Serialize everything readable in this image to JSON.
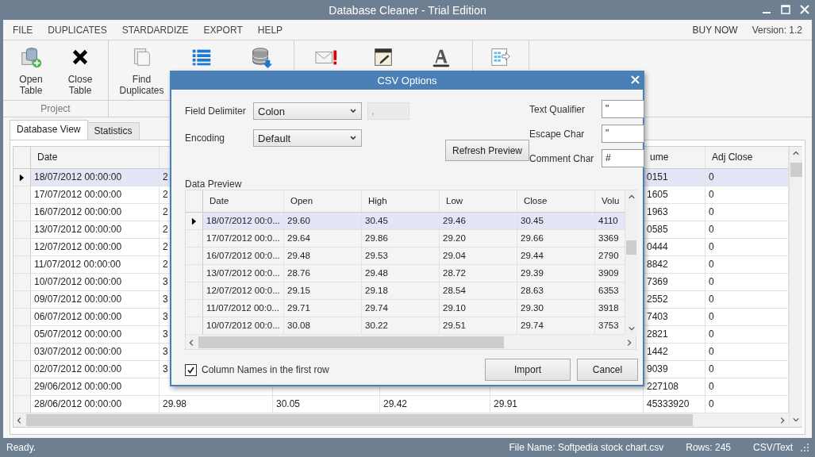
{
  "window": {
    "title": "Database Cleaner - Trial Edition"
  },
  "menu": {
    "items": [
      {
        "label": "FILE"
      },
      {
        "label": "DUPLICATES"
      },
      {
        "label": "STARDARDIZE"
      },
      {
        "label": "EXPORT"
      },
      {
        "label": "HELP"
      }
    ],
    "right": [
      {
        "label": "BUY NOW",
        "kind": "link"
      },
      {
        "label": "Version: 1.2",
        "kind": "text"
      }
    ]
  },
  "ribbon": {
    "groups": [
      {
        "label": "Project",
        "buttons": [
          {
            "kind": "database-add",
            "label": "Open Table"
          },
          {
            "kind": "close",
            "label": "Close Table"
          }
        ]
      },
      {
        "buttons": [
          {
            "kind": "pages",
            "label": "Find Duplicates"
          },
          {
            "kind": "list"
          },
          {
            "kind": "database-download"
          }
        ]
      },
      {
        "buttons": [
          {
            "kind": "mail-alert"
          },
          {
            "kind": "notepad"
          },
          {
            "kind": "text-style"
          }
        ]
      },
      {
        "buttons": [
          {
            "kind": "sheet-export"
          }
        ]
      }
    ]
  },
  "tabs": [
    {
      "label": "Database View",
      "selected": true
    },
    {
      "label": "Statistics",
      "selected": false
    }
  ],
  "grid": {
    "columns": [
      {
        "label": "Date"
      },
      {},
      {},
      {},
      {},
      {
        "label": "ume"
      },
      {
        "label": "Adj Close"
      }
    ],
    "rows": [
      {
        "selected": true,
        "cells": [
          "18/07/2012 00:00:00",
          "2",
          null,
          null,
          null,
          "0151",
          "0"
        ]
      },
      {
        "selected": false,
        "cells": [
          "17/07/2012 00:00:00",
          "2",
          null,
          null,
          null,
          "1605",
          "0"
        ]
      },
      {
        "selected": false,
        "cells": [
          "16/07/2012 00:00:00",
          "2",
          null,
          null,
          null,
          "1963",
          "0"
        ]
      },
      {
        "selected": false,
        "cells": [
          "13/07/2012 00:00:00",
          "2",
          null,
          null,
          null,
          "0585",
          "0"
        ]
      },
      {
        "selected": false,
        "cells": [
          "12/07/2012 00:00:00",
          "2",
          null,
          null,
          null,
          "0444",
          "0"
        ]
      },
      {
        "selected": false,
        "cells": [
          "11/07/2012 00:00:00",
          "2",
          null,
          null,
          null,
          "8842",
          "0"
        ]
      },
      {
        "selected": false,
        "cells": [
          "10/07/2012 00:00:00",
          "3",
          null,
          null,
          null,
          "7369",
          "0"
        ]
      },
      {
        "selected": false,
        "cells": [
          "09/07/2012 00:00:00",
          "3",
          null,
          null,
          null,
          "2552",
          "0"
        ]
      },
      {
        "selected": false,
        "cells": [
          "06/07/2012 00:00:00",
          "3",
          null,
          null,
          null,
          "7403",
          "0"
        ]
      },
      {
        "selected": false,
        "cells": [
          "05/07/2012 00:00:00",
          "3",
          null,
          null,
          null,
          "2821",
          "0"
        ]
      },
      {
        "selected": false,
        "cells": [
          "03/07/2012 00:00:00",
          "3",
          null,
          null,
          null,
          "1442",
          "0"
        ]
      },
      {
        "selected": false,
        "cells": [
          "02/07/2012 00:00:00",
          "3",
          null,
          null,
          null,
          "9039",
          "0"
        ]
      },
      {
        "selected": false,
        "cells": [
          "29/06/2012 00:00:00",
          null,
          null,
          null,
          null,
          "227108",
          "0"
        ]
      },
      {
        "selected": false,
        "cells": [
          "28/06/2012 00:00:00",
          "29.98",
          "30.05",
          "29.42",
          "29.91",
          "45333920",
          "0"
        ]
      }
    ]
  },
  "dialog": {
    "title": "CSV Options",
    "field_delimiter": {
      "label": "Field Delimiter",
      "value": "Colon"
    },
    "delimiter_char": {
      "value": ",",
      "disabled": true
    },
    "encoding": {
      "label": "Encoding",
      "value": "Default"
    },
    "refresh_button": "Refresh Preview",
    "text_qualifier": {
      "label": "Text Qualifier",
      "value": "\""
    },
    "escape_char": {
      "label": "Escape Char",
      "value": "\""
    },
    "comment_char": {
      "label": "Comment Char",
      "value": "#"
    },
    "preview_label": "Data Preview",
    "preview": {
      "columns": [
        "Date",
        "Open",
        "High",
        "Low",
        "Close",
        "Volu"
      ],
      "rows": [
        {
          "selected": true,
          "cells": [
            "18/07/2012 00:0...",
            "29.60",
            "30.45",
            "29.46",
            "30.45",
            "4110"
          ]
        },
        {
          "selected": false,
          "cells": [
            "17/07/2012 00:0...",
            "29.64",
            "29.86",
            "29.20",
            "29.66",
            "3369"
          ]
        },
        {
          "selected": false,
          "cells": [
            "16/07/2012 00:0...",
            "29.48",
            "29.53",
            "29.04",
            "29.44",
            "2790"
          ]
        },
        {
          "selected": false,
          "cells": [
            "13/07/2012 00:0...",
            "28.76",
            "29.48",
            "28.72",
            "29.39",
            "3909"
          ]
        },
        {
          "selected": false,
          "cells": [
            "12/07/2012 00:0...",
            "29.15",
            "29.18",
            "28.54",
            "28.63",
            "6353"
          ]
        },
        {
          "selected": false,
          "cells": [
            "11/07/2012 00:0...",
            "29.71",
            "29.74",
            "29.10",
            "29.30",
            "3918"
          ]
        },
        {
          "selected": false,
          "cells": [
            "10/07/2012 00:0...",
            "30.08",
            "30.22",
            "29.51",
            "29.74",
            "3753"
          ]
        }
      ]
    },
    "first_row_names": {
      "label": "Column Names in the first row",
      "checked": true
    },
    "buttons": [
      "Import",
      "Cancel"
    ]
  },
  "status_bar": {
    "message": "Ready.",
    "file_name": "File Name: Softpedia stock chart.csv",
    "rows": "Rows: 245",
    "format": "CSV/Text"
  }
}
